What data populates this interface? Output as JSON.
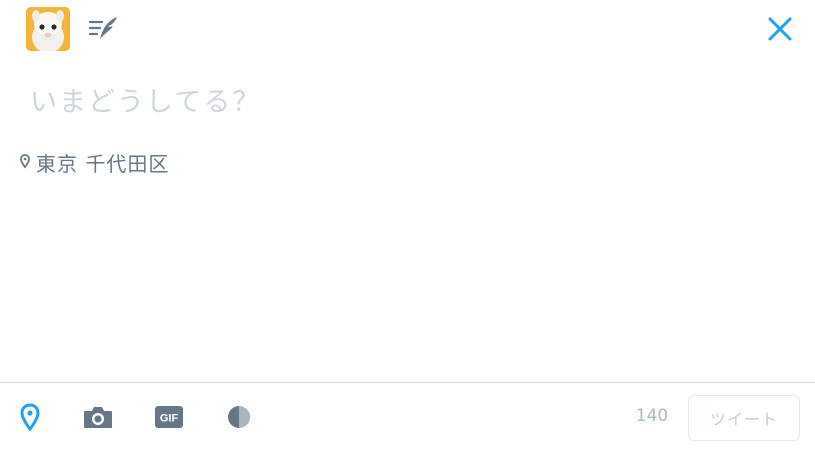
{
  "compose": {
    "placeholder": "いまどうしてる？",
    "value": ""
  },
  "location": {
    "label": "東京 千代田区",
    "icon": "map-pin-icon"
  },
  "toolbar": {
    "icons": [
      "location-icon",
      "camera-icon",
      "gif-icon",
      "poll-icon"
    ],
    "gif_label": "GIF",
    "char_count": "140",
    "tweet_label": "ツイート"
  },
  "header": {
    "icons": [
      "avatar",
      "drafts-icon",
      "close-icon"
    ]
  },
  "colors": {
    "accent": "#1da1f2",
    "icon_gray": "#657786",
    "placeholder": "#cdd5dd",
    "divider": "#cfd9de"
  }
}
